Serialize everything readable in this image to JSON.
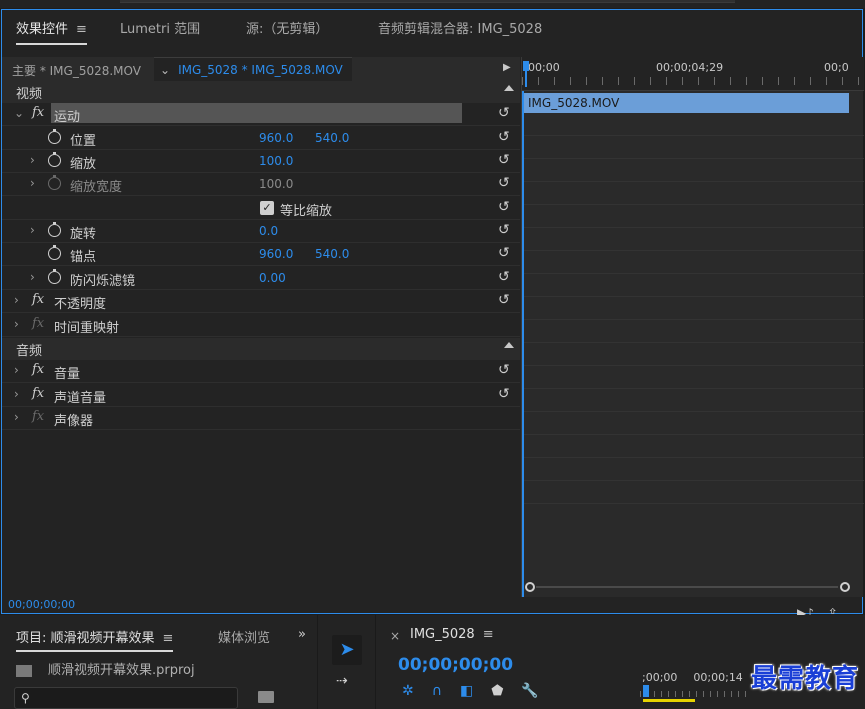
{
  "tabs": [
    {
      "label": "效果控件",
      "active": true
    },
    {
      "label": "Lumetri 范围"
    },
    {
      "label": "源:（无剪辑）"
    },
    {
      "label": "音频剪辑混合器: IMG_5028"
    }
  ],
  "menu_icon": "≡",
  "source": {
    "master": "主要 * IMG_5028.MOV",
    "clip": "IMG_5028 * IMG_5028.MOV"
  },
  "sections": {
    "video": "视频",
    "audio": "音频"
  },
  "effects": {
    "motion": "运动",
    "position": {
      "label": "位置",
      "x": "960.0",
      "y": "540.0"
    },
    "scale": {
      "label": "缩放",
      "value": "100.0"
    },
    "scale_width": {
      "label": "缩放宽度",
      "value": "100.0"
    },
    "uniform_scale": {
      "label": "等比缩放",
      "checked": true
    },
    "rotation": {
      "label": "旋转",
      "value": "0.0"
    },
    "anchor": {
      "label": "锚点",
      "x": "960.0",
      "y": "540.0"
    },
    "antiflicker": {
      "label": "防闪烁滤镜",
      "value": "0.00"
    },
    "opacity": "不透明度",
    "time_remap": "时间重映射",
    "volume": "音量",
    "channel_volume": "声道音量",
    "panner": "声像器"
  },
  "timeline": {
    "t0": "00;00",
    "t1": "00;00;04;29",
    "t2": "00;0",
    "clip_name": "IMG_5028.MOV"
  },
  "current_timecode": "00;00;00;00",
  "project": {
    "tab_label": "项目: 顺滑视频开幕效果",
    "media_tab": "媒体浏览",
    "chevrons": "»",
    "file": "顺滑视频开幕效果.prproj"
  },
  "sequence": {
    "close": "×",
    "name": "IMG_5028",
    "timecode": "00;00;00;00",
    "ruler_start": ";00;00",
    "ruler_next": "00;00;14"
  },
  "watermark": "最需教育",
  "colors": {
    "accent": "#2d8ceb",
    "clip": "#6b9ed8"
  }
}
